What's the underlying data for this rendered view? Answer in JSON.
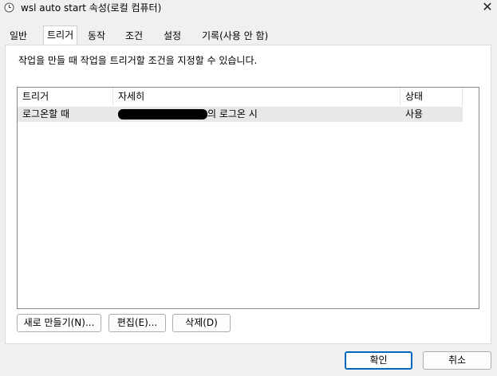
{
  "window": {
    "title": "wsl auto start 속성(로컬 컴퓨터)",
    "close_glyph": "✕"
  },
  "tabs": [
    {
      "label": "일반"
    },
    {
      "label": "트리거",
      "active": true
    },
    {
      "label": "동작"
    },
    {
      "label": "조건"
    },
    {
      "label": "설정"
    },
    {
      "label": "기록(사용 안 함)"
    }
  ],
  "panel": {
    "description": "작업을 만들 때 작업을 트리거할 조건을 지정할 수 있습니다."
  },
  "table": {
    "columns": [
      "트리거",
      "자세히",
      "상태"
    ],
    "rows": [
      {
        "trigger": "로그온할 때",
        "detail_suffix": "의 로그온 시",
        "status": "사용"
      }
    ]
  },
  "buttons": {
    "new": "새로 만들기(N)...",
    "edit": "편집(E)...",
    "delete": "삭제(D)",
    "ok": "확인",
    "cancel": "취소"
  }
}
